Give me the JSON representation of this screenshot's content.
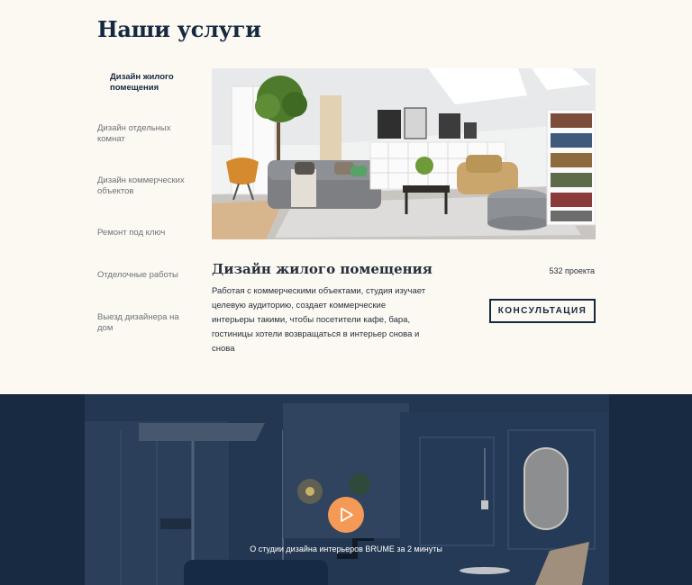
{
  "services": {
    "title": "Наши услуги",
    "menu": [
      "Дизайн жилого помещения",
      "Дизайн отдельных комнат",
      "Дизайн коммерческих объектов",
      "Ремонт под ключ",
      "Отделочные работы",
      "Выезд дизайнера на дом"
    ],
    "active_index": 0,
    "detail": {
      "title": "Дизайн жилого помещения",
      "count": "532 проекта",
      "description": "Работая с коммерческими объектами, студия изучает целевую аудиторию, создает коммерческие интерьеры такими, чтобы посетители кафе, бара, гостиницы хотели возвращаться в интерьер снова и снова",
      "button": "КОНСУЛЬТАЦИЯ"
    }
  },
  "video": {
    "caption": "О студии дизайна интерьеров BRUME за 2 минуты"
  },
  "colors": {
    "navy": "#152840",
    "cream": "#fcf9f3",
    "accent": "#f49a56"
  }
}
